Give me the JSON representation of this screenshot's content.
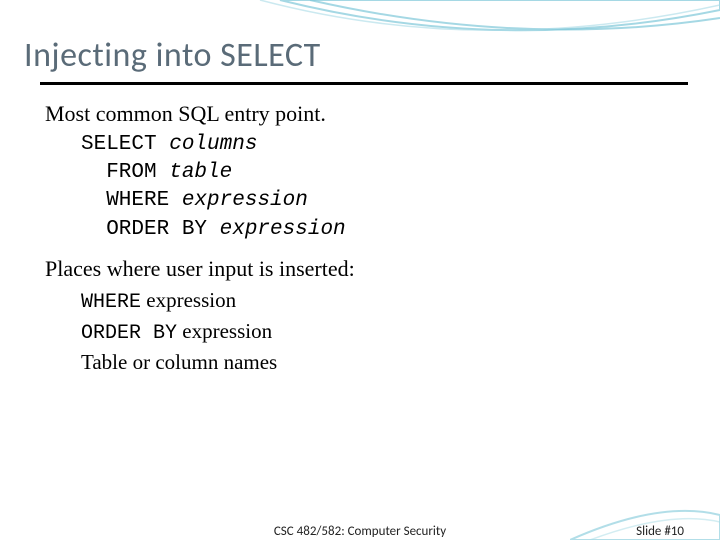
{
  "title": "Injecting into SELECT",
  "section1": {
    "heading": "Most common SQL entry point.",
    "code": {
      "l1_kw": "SELECT ",
      "l1_it": "columns",
      "l2_kw": "  FROM ",
      "l2_it": "table",
      "l3_kw": "  WHERE ",
      "l3_it": "expression",
      "l4_kw": "  ORDER BY ",
      "l4_it": "expression"
    }
  },
  "section2": {
    "heading": "Places where user input is inserted:",
    "items": {
      "i1_mono": "WHERE",
      "i1_rest": " expression",
      "i2_mono": "ORDER BY",
      "i2_rest": " expression",
      "i3": "Table or column names"
    }
  },
  "footer": {
    "center": "CSC 482/582: Computer Security",
    "right": "Slide #10"
  }
}
